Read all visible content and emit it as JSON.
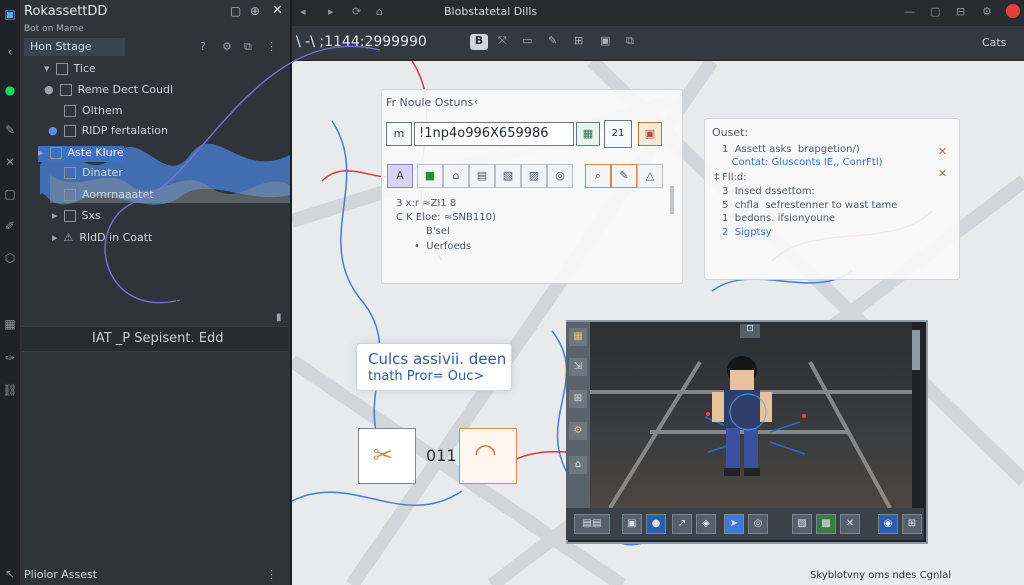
{
  "app": {
    "title": "RokassettDD",
    "subtitle": "Bot on Mame"
  },
  "left_panel": {
    "tab": "Hon Sttage",
    "tree": [
      {
        "label": "Tice"
      },
      {
        "label": "Reme Dect Coudl"
      },
      {
        "label": "Olthem"
      },
      {
        "label": "RlDP fertalation"
      },
      {
        "label": "Aste Klure"
      },
      {
        "label": "Dinater"
      },
      {
        "label": "Aomrnaaatet"
      },
      {
        "label": "Sxs"
      },
      {
        "label": "RldD in Coatt"
      }
    ],
    "footer_label": "IAT _P Sepisent. Edd",
    "bottom_label": "Pliolor Assest"
  },
  "topbar": {
    "title": "Blobstatetal Dills"
  },
  "toolbar": {
    "coords": "\\ -\\ ;1144:2999990",
    "right_label": "Cats"
  },
  "props_card": {
    "header": "Fr Noule Ostuns",
    "id_prefix": "m",
    "id_value": "!1np4o996X659986",
    "spin_label": "21",
    "lines": [
      "3 x:r ≈ZI1 8",
      "C K Eloe:  ≈SNB110)",
      "B'sel"
    ],
    "bullet": "Uerfoeds"
  },
  "info_card": {
    "title": "Ouset:",
    "lines": [
      "1  Assett asks  brapgetion/)",
      "   Contat: Glusconts IE,, ConrFtl)",
      "‡ Fll:d:",
      "3  Insed dssettom:",
      "5  chfla  sefrestenner to wast tame",
      "1  bedons. ifsionyoune",
      "2  Sigptsy"
    ]
  },
  "note_bubble": {
    "line1": "Culcs assivii. deen",
    "line2": "tnath Pror= Ouc>"
  },
  "node_number": "011",
  "status": {
    "right": "Skyblotvny oms ndes  Cgnlal"
  },
  "colors": {
    "accent": "#3d6fc2",
    "brand": "#e0423a"
  }
}
